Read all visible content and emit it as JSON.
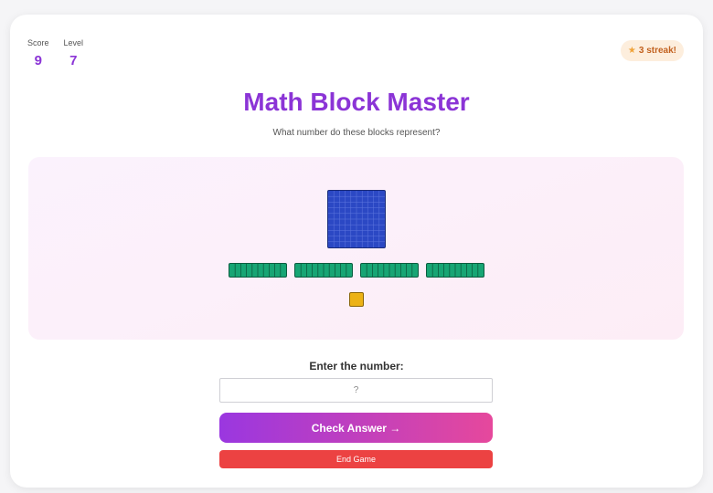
{
  "stats": {
    "score_label": "Score",
    "score_value": "9",
    "level_label": "Level",
    "level_value": "7"
  },
  "streak": {
    "icon": "star-icon",
    "glyph": "★",
    "label": "3 streak!"
  },
  "title": "Math Block Master",
  "subtitle": "What number do these blocks represent?",
  "blocks": {
    "hundreds": 1,
    "tens": 4,
    "ones": 1
  },
  "answer": {
    "label": "Enter the number:",
    "placeholder": "?",
    "value": ""
  },
  "buttons": {
    "check": "Check Answer →",
    "end": "End Game"
  },
  "colors": {
    "accent": "#8b34d6",
    "hundred_block": "#2b48c4",
    "ten_block": "#17a574",
    "one_block": "#ecb216",
    "end_button": "#ec4242"
  }
}
